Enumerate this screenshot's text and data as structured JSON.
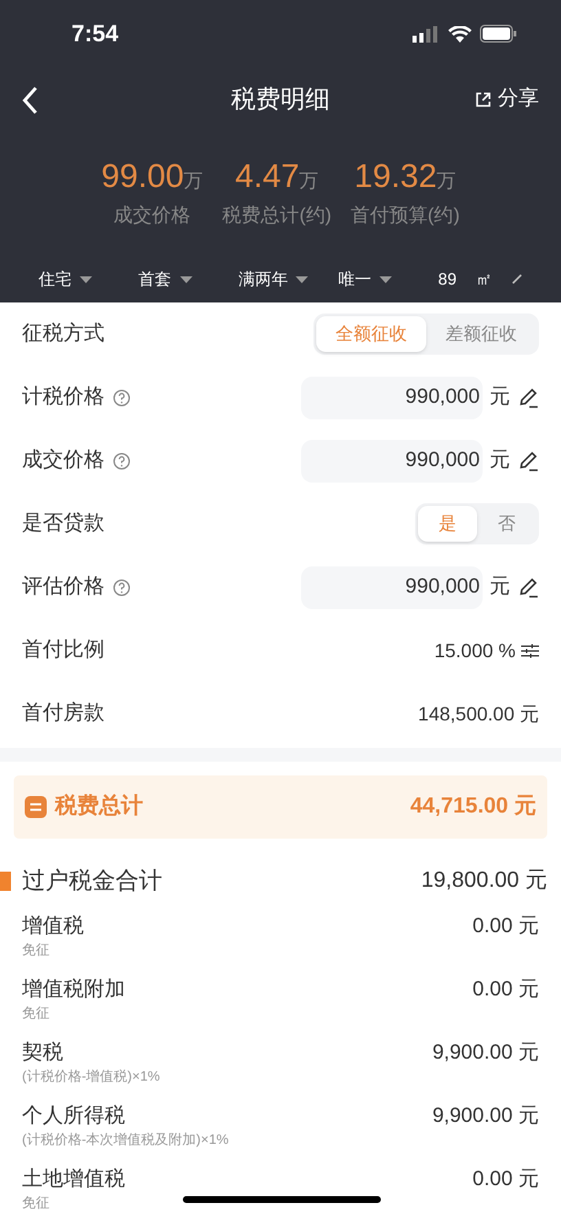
{
  "status_bar": {
    "time": "7:54"
  },
  "nav": {
    "title": "税费明细",
    "share": "分享"
  },
  "summary": [
    {
      "value": "99.00",
      "unit": "万",
      "label": "成交价格"
    },
    {
      "value": "4.47",
      "unit": "万",
      "label": "税费总计(约)"
    },
    {
      "value": "19.32",
      "unit": "万",
      "label": "首付预算(约)"
    }
  ],
  "filters": [
    {
      "label": "住宅"
    },
    {
      "label": "首套"
    },
    {
      "label": "满两年"
    },
    {
      "label": "唯一"
    }
  ],
  "area": {
    "value": "89",
    "unit": "㎡"
  },
  "form": [
    {
      "kind": "segmented",
      "label": "征税方式",
      "options": [
        {
          "label": "全额征收",
          "selected": true
        },
        {
          "label": "差额征收",
          "selected": false
        }
      ]
    },
    {
      "kind": "input",
      "label": "计税价格",
      "help": true,
      "value": "990,000",
      "unit": "元"
    },
    {
      "kind": "input",
      "label": "成交价格",
      "help": true,
      "value": "990,000",
      "unit": "元"
    },
    {
      "kind": "segmented",
      "label": "是否贷款",
      "options": [
        {
          "label": "是",
          "selected": true
        },
        {
          "label": "否",
          "selected": false
        }
      ]
    },
    {
      "kind": "input",
      "label": "评估价格",
      "help": true,
      "value": "990,000",
      "unit": "元"
    },
    {
      "kind": "ratio",
      "label": "首付比例",
      "value": "15.000 %"
    },
    {
      "kind": "value",
      "label": "首付房款",
      "value": "148,500.00 元"
    }
  ],
  "total": {
    "label": "税费总计",
    "amount": "44,715.00 元"
  },
  "section": {
    "title": "过户税金合计",
    "amount": "19,800.00 元",
    "items": [
      {
        "name": "增值税",
        "note": "免征",
        "amount": "0.00 元"
      },
      {
        "name": "增值税附加",
        "note": "免征",
        "amount": "0.00 元"
      },
      {
        "name": "契税",
        "note": "(计税价格-增值税)×1%",
        "amount": "9,900.00 元"
      },
      {
        "name": "个人所得税",
        "note": "(计税价格-本次增值税及附加)×1%",
        "amount": "9,900.00 元"
      },
      {
        "name": "土地增值税",
        "note": "免征",
        "amount": "0.00 元"
      }
    ]
  }
}
